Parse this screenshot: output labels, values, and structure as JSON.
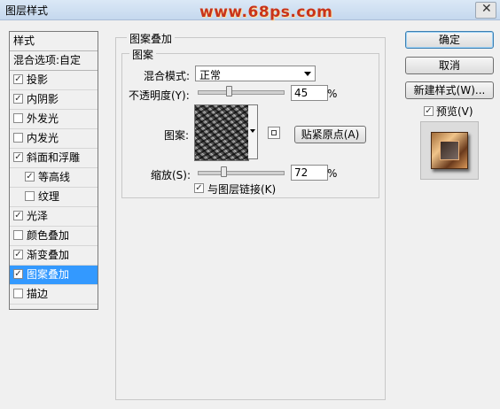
{
  "window": {
    "title": "图层样式",
    "watermark": "www.68ps.com",
    "close_glyph": "✕"
  },
  "sidebar": {
    "header": "样式",
    "blend_options": "混合选项:自定",
    "items": [
      {
        "label": "投影",
        "checked": true,
        "sub": false,
        "active": false
      },
      {
        "label": "内阴影",
        "checked": true,
        "sub": false,
        "active": false
      },
      {
        "label": "外发光",
        "checked": false,
        "sub": false,
        "active": false
      },
      {
        "label": "内发光",
        "checked": false,
        "sub": false,
        "active": false
      },
      {
        "label": "斜面和浮雕",
        "checked": true,
        "sub": false,
        "active": false
      },
      {
        "label": "等高线",
        "checked": true,
        "sub": true,
        "active": false
      },
      {
        "label": "纹理",
        "checked": false,
        "sub": true,
        "active": false
      },
      {
        "label": "光泽",
        "checked": true,
        "sub": false,
        "active": false
      },
      {
        "label": "颜色叠加",
        "checked": false,
        "sub": false,
        "active": false
      },
      {
        "label": "渐变叠加",
        "checked": true,
        "sub": false,
        "active": false
      },
      {
        "label": "图案叠加",
        "checked": true,
        "sub": false,
        "active": true
      },
      {
        "label": "描边",
        "checked": false,
        "sub": false,
        "active": false
      }
    ]
  },
  "panel": {
    "outer_title": "图案叠加",
    "inner_title": "图案",
    "blend_mode_label": "混合模式:",
    "blend_mode_value": "正常",
    "opacity_label": "不透明度(Y):",
    "opacity_value": "45",
    "opacity_level": 45,
    "percent": "%",
    "pattern_label": "图案:",
    "snap_button": "贴紧原点(A)",
    "scale_label": "缩放(S):",
    "scale_value": "72",
    "scale_level": 72,
    "link_label": "与图层链接(K)",
    "link_checked": true
  },
  "right": {
    "ok": "确定",
    "cancel": "取消",
    "new_style": "新建样式(W)...",
    "preview_label": "预览(V)",
    "preview_checked": true
  },
  "colors": {
    "accent": "#3399ff",
    "watermark": "#c8341a"
  }
}
